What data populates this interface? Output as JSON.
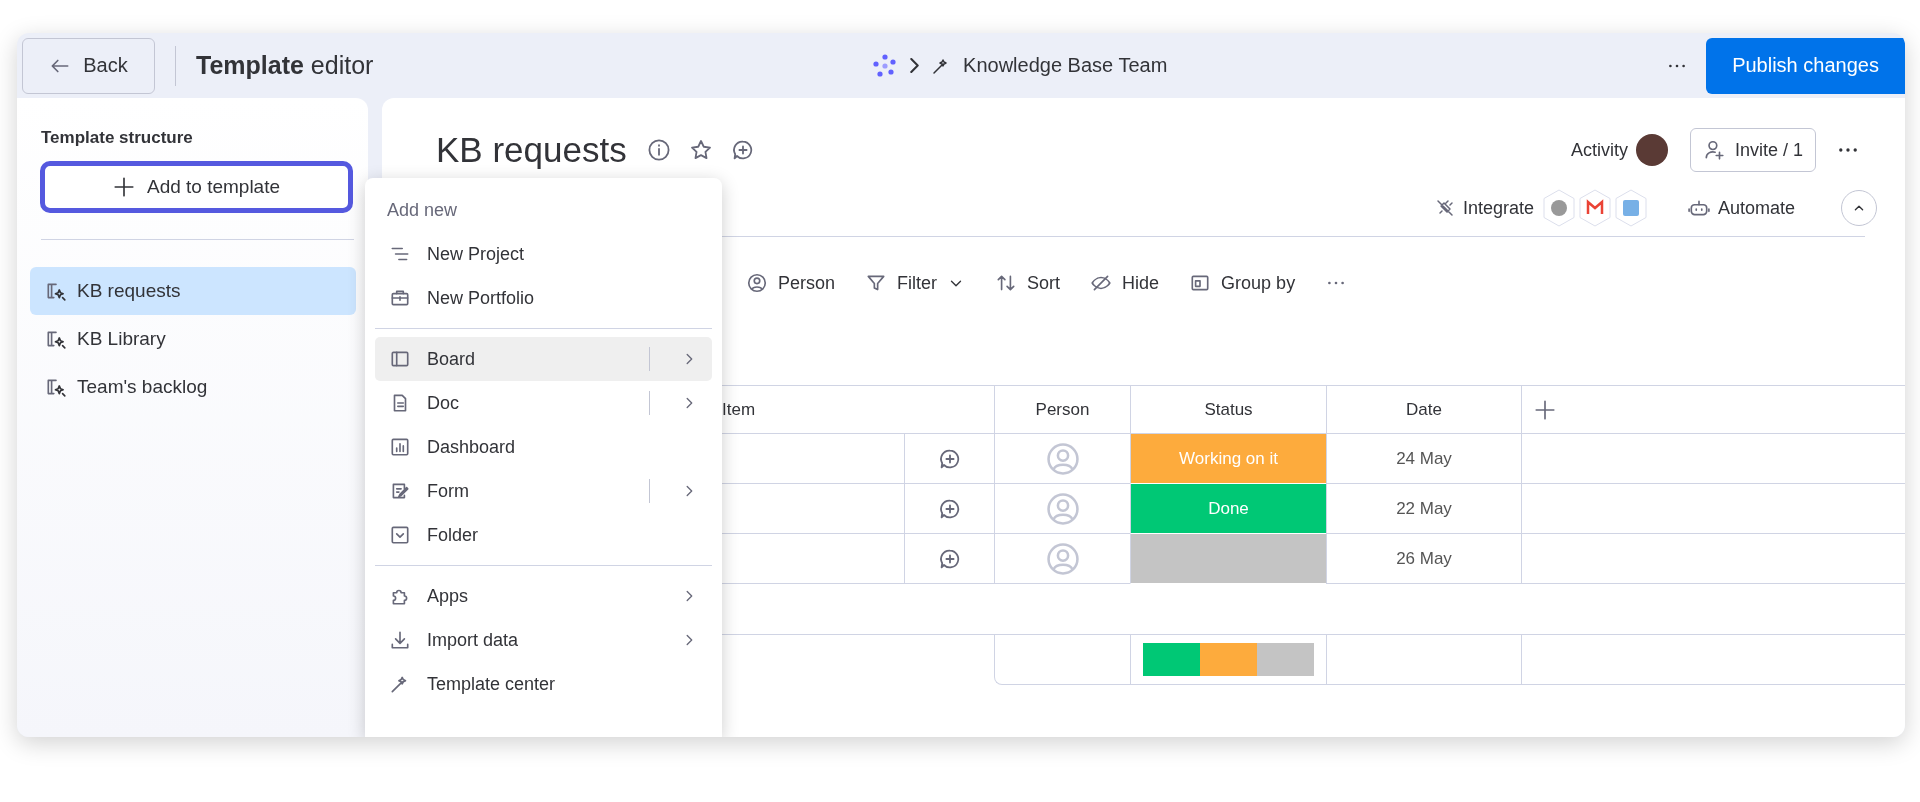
{
  "topbar": {
    "back_button": "Back",
    "title": "**Template** editor",
    "breadcrumb": "Knowledge Base Team",
    "publish_button": "Publish changes"
  },
  "sidebar": {
    "heading": "Template structure",
    "add_button": "Add to template",
    "items": [
      {
        "label": "KB requests",
        "selected": true
      },
      {
        "label": "KB Library",
        "selected": false
      },
      {
        "label": "Team's backlog",
        "selected": false
      }
    ]
  },
  "menu": {
    "heading": "Add new",
    "sections": [
      {
        "items": [
          {
            "label": "New Project",
            "kind": "plain",
            "highlighted": false
          },
          {
            "label": "New Portfolio",
            "kind": "plain",
            "highlighted": false
          }
        ]
      },
      {
        "items": [
          {
            "label": "Board",
            "kind": "split",
            "highlighted": true
          },
          {
            "label": "Doc",
            "kind": "split",
            "highlighted": false
          },
          {
            "label": "Dashboard",
            "kind": "plain",
            "highlighted": false
          },
          {
            "label": "Form",
            "kind": "split",
            "highlighted": false
          },
          {
            "label": "Folder",
            "kind": "plain",
            "highlighted": false
          }
        ]
      },
      {
        "items": [
          {
            "label": "Apps",
            "kind": "submenu",
            "highlighted": false
          },
          {
            "label": "Import data",
            "kind": "submenu",
            "highlighted": false
          },
          {
            "label": "Template center",
            "kind": "plain",
            "highlighted": false
          }
        ]
      }
    ]
  },
  "board": {
    "title": "KB requests",
    "activity": "Activity",
    "invite_button": "Invite / 1",
    "integrate": "Integrate",
    "automate": "Automate",
    "toolbar": [
      "Person",
      "Filter",
      "Sort",
      "Hide",
      "Group by"
    ]
  },
  "table": {
    "columns": [
      "Item",
      "Person",
      "Status",
      "Date"
    ],
    "rows": [
      {
        "status": {
          "label": "Working on it",
          "color": "#fdab3d"
        },
        "date": "24 May"
      },
      {
        "status": {
          "label": "Done",
          "color": "#00c875"
        },
        "date": "22 May"
      },
      {
        "status": {
          "color": "#c4c4c4"
        },
        "date": "26 May"
      }
    ],
    "summary": [
      {
        "color": "#00c875"
      },
      {
        "color": "#fdab3d"
      },
      {
        "color": "#c4c4c4"
      }
    ]
  }
}
